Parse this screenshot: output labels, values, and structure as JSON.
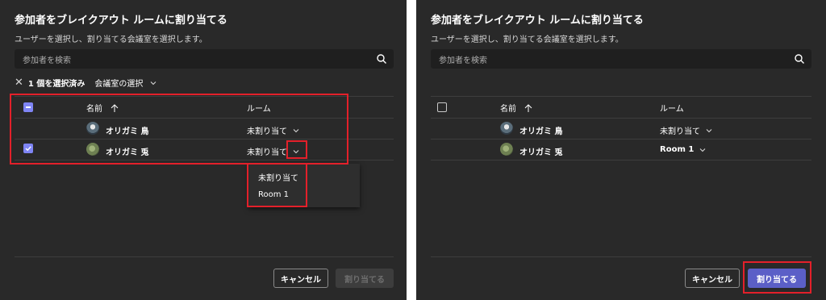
{
  "left": {
    "title": "参加者をブレイクアウト ルームに割り当てる",
    "subtitle": "ユーザーを選択し、割り当てる会議室を選択します。",
    "search_placeholder": "参加者を検索",
    "selection": {
      "clear_glyph": "✕",
      "count_label": "1 個を選択済み",
      "room_select_label": "会議室の選択"
    },
    "table": {
      "col_name": "名前",
      "col_room": "ルーム",
      "rows": [
        {
          "name": "オリガミ 鳥",
          "room": "未割り当て",
          "checked": false
        },
        {
          "name": "オリガミ 兎",
          "room": "未割り当て",
          "checked": true
        }
      ]
    },
    "dropdown": {
      "options": [
        "未割り当て",
        "Room 1"
      ]
    },
    "buttons": {
      "cancel": "キャンセル",
      "assign": "割り当てる"
    }
  },
  "right": {
    "title": "参加者をブレイクアウト ルームに割り当てる",
    "subtitle": "ユーザーを選択し、割り当てる会議室を選択します。",
    "search_placeholder": "参加者を検索",
    "table": {
      "col_name": "名前",
      "col_room": "ルーム",
      "rows": [
        {
          "name": "オリガミ 鳥",
          "room": "未割り当て",
          "checked": false
        },
        {
          "name": "オリガミ 兎",
          "room": "Room 1",
          "checked": false
        }
      ]
    },
    "buttons": {
      "cancel": "キャンセル",
      "assign": "割り当てる"
    }
  },
  "colors": {
    "accent": "#5b5fc7",
    "highlight": "#e3202a",
    "panel_bg": "#292929"
  },
  "icons": [
    "search-icon",
    "close-icon",
    "chevron-down-icon",
    "sort-up-arrow-icon"
  ]
}
